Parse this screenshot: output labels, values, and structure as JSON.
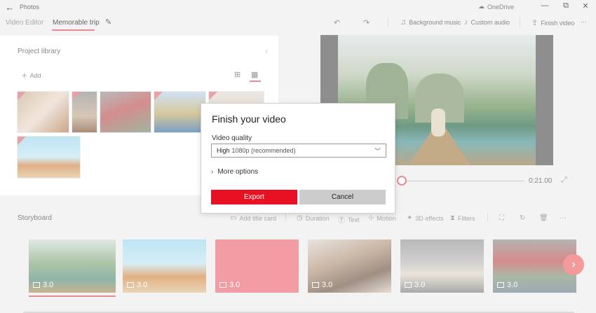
{
  "titlebar": {
    "back_glyph": "←",
    "app_name": "Photos",
    "onedrive_label": "OneDrive",
    "minimize_glyph": "—",
    "maximize_glyph": "⧉",
    "close_glyph": "✕"
  },
  "appbar": {
    "breadcrumb_parent": "Video Editor",
    "project_name": "Memorable trip",
    "undo_glyph": "↶",
    "redo_glyph": "↷",
    "background_music": "Background music",
    "custom_audio": "Custom audio",
    "finish_video": "Finish video",
    "more_glyph": "···"
  },
  "library": {
    "title": "Project library",
    "add_label": "Add",
    "collapse_glyph": "‹"
  },
  "preview": {
    "timecode": "0:21.00",
    "progress_fraction": 0.0
  },
  "storyboard": {
    "title": "Storyboard",
    "tools": {
      "add_title_card": "Add title card",
      "duration": "Duration",
      "text": "Text",
      "motion": "Motion",
      "effects_3d": "3D effects",
      "filters": "Filters"
    },
    "clips": [
      {
        "duration": "3.0"
      },
      {
        "duration": "3.0"
      },
      {
        "duration": "3.0"
      },
      {
        "duration": "3.0"
      },
      {
        "duration": "3.0"
      },
      {
        "duration": "3.0"
      }
    ],
    "next_glyph": "›"
  },
  "dialog": {
    "title": "Finish your video",
    "quality_label": "Video quality",
    "quality_level": "High",
    "quality_detail": "1080p (recommended)",
    "more_options": "More options",
    "export_label": "Export",
    "cancel_label": "Cancel"
  },
  "colors": {
    "accent": "#e81123",
    "highlight": "#e88a93"
  }
}
